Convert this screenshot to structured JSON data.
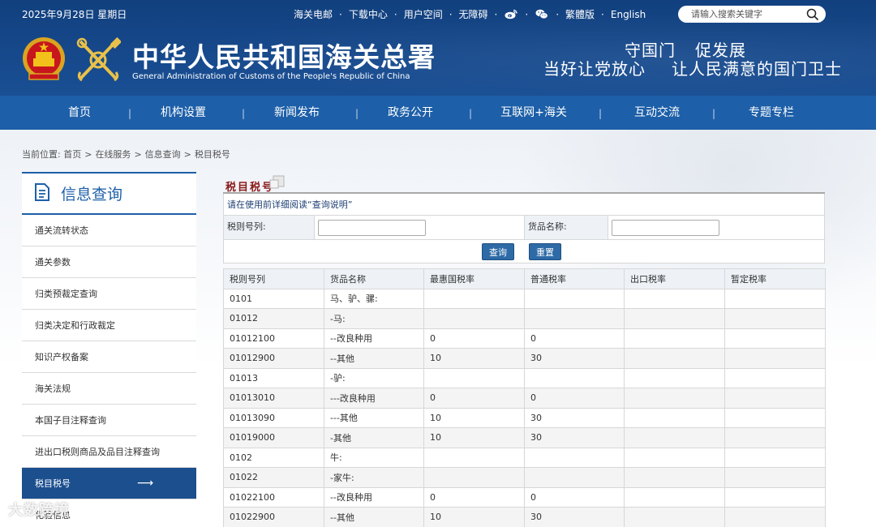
{
  "header": {
    "date": "2025年9月28日 星期日",
    "top_links": [
      "海关电邮",
      "下载中心",
      "用户空间",
      "无障碍"
    ],
    "lang_links": [
      "繁體版",
      "English"
    ],
    "search_placeholder": "请输入搜索关键字",
    "title": "中华人民共和国海关总署",
    "subtitle": "General Administration of Customs of the People's Republic of China",
    "slogan_line1": [
      "守国门",
      "促发展"
    ],
    "slogan_line2": [
      "当好让党放心",
      "让人民满意的国门卫士"
    ],
    "icons": [
      "weibo-icon",
      "wechat-icon",
      "search-icon"
    ]
  },
  "nav": [
    "首页",
    "机构设置",
    "新闻发布",
    "政务公开",
    "互联网+海关",
    "互动交流",
    "专题专栏"
  ],
  "breadcrumb": {
    "prefix": "当前位置:",
    "items": [
      "首页",
      "在线服务",
      "信息查询",
      "税目税号"
    ]
  },
  "sidebar": {
    "title": "信息查询",
    "items": [
      "通关流转状态",
      "通关参数",
      "归类预裁定查询",
      "归类决定和行政裁定",
      "知识产权备案",
      "海关法规",
      "本国子目注释查询",
      "进出口税则商品及品目注释查询",
      "税目税号",
      "化验信息"
    ],
    "active": "税目税号"
  },
  "main": {
    "title": "税目税号",
    "notice": "请在使用前详细阅读“查询说明”",
    "form": {
      "code_label": "税则号列:",
      "code_value": "",
      "name_label": "货品名称:",
      "name_value": ""
    },
    "buttons": {
      "query": "查询",
      "reset": "重置"
    },
    "table": {
      "headers": [
        "税则号列",
        "货品名称",
        "最惠国税率",
        "普通税率",
        "出口税率",
        "暂定税率"
      ],
      "rows": [
        [
          "0101",
          "马、驴、骡:",
          "",
          "",
          "",
          ""
        ],
        [
          "01012",
          "-马:",
          "",
          "",
          "",
          ""
        ],
        [
          "01012100",
          "--改良种用",
          "0",
          "0",
          "",
          ""
        ],
        [
          "01012900",
          "--其他",
          "10",
          "30",
          "",
          ""
        ],
        [
          "01013",
          "-驴:",
          "",
          "",
          "",
          ""
        ],
        [
          "01013010",
          "---改良种用",
          "0",
          "0",
          "",
          ""
        ],
        [
          "01013090",
          "---其他",
          "10",
          "30",
          "",
          ""
        ],
        [
          "01019000",
          "-其他",
          "10",
          "30",
          "",
          ""
        ],
        [
          "0102",
          "牛:",
          "",
          "",
          "",
          ""
        ],
        [
          "01022",
          "-家牛:",
          "",
          "",
          "",
          ""
        ],
        [
          "01022100",
          "--改良种用",
          "0",
          "0",
          "",
          ""
        ],
        [
          "01022900",
          "--其他",
          "10",
          "30",
          "",
          ""
        ]
      ]
    }
  },
  "watermark": "大数跨境",
  "colors": {
    "header_bg": "#16498c",
    "nav_bg": "#1d5fa8",
    "sidebar_active": "#1b4f8e",
    "title_red": "#8b1a1a",
    "button_bg": "#2d6aa6"
  }
}
